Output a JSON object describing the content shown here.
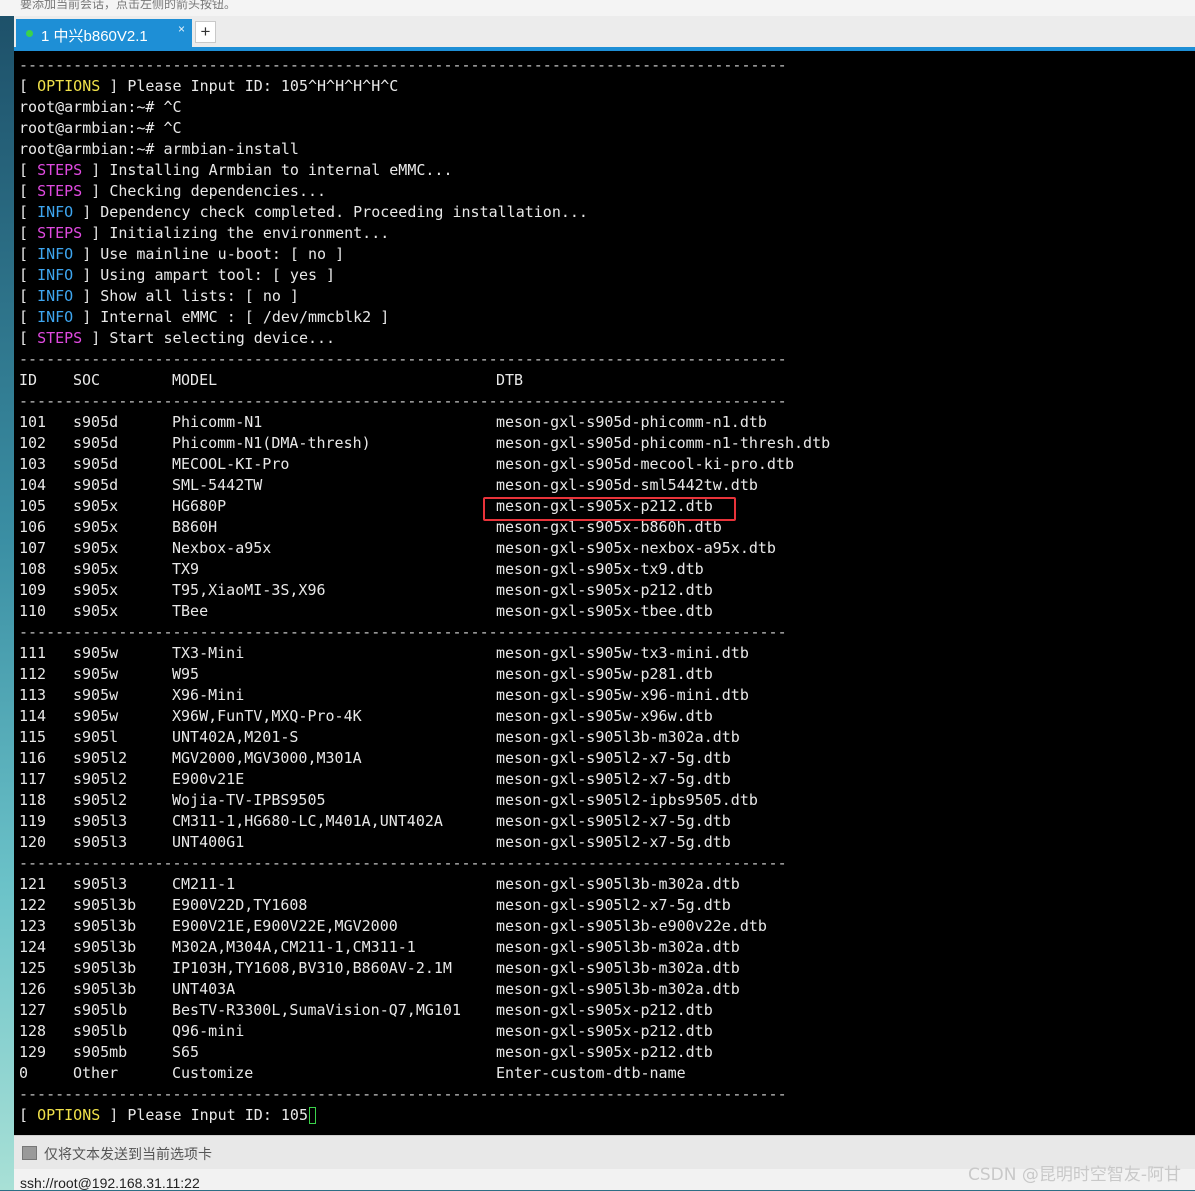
{
  "top_strip_text": "要添加当前会话，点击左侧的箭头按钮。",
  "tab": {
    "label": "1 中兴b860V2.1",
    "close": "×"
  },
  "new_tab_button": "+",
  "terminal": {
    "separator": "-------------------------------------------------------------------------------------",
    "pre_lines": [
      {
        "tag": "OPTIONS",
        "tag_color": "yellow",
        "text": "Please Input ID: 105^H^H^H^H^C"
      },
      {
        "plain": "root@armbian:~# ^C"
      },
      {
        "plain": "root@armbian:~# ^C"
      },
      {
        "plain": "root@armbian:~# armbian-install"
      },
      {
        "tag": "STEPS",
        "tag_color": "magenta",
        "text": "Installing Armbian to internal eMMC..."
      },
      {
        "tag": "STEPS",
        "tag_color": "magenta",
        "text": "Checking dependencies..."
      },
      {
        "tag": "INFO",
        "tag_color": "cyan",
        "text": "Dependency check completed. Proceeding installation..."
      },
      {
        "tag": "STEPS",
        "tag_color": "magenta",
        "text": "Initializing the environment..."
      },
      {
        "tag": "INFO",
        "tag_color": "cyan",
        "text": "Use mainline u-boot: [ no ]"
      },
      {
        "tag": "INFO",
        "tag_color": "cyan",
        "text": "Using ampart tool: [ yes ]"
      },
      {
        "tag": "INFO",
        "tag_color": "cyan",
        "text": "Show all lists: [ no ]"
      },
      {
        "tag": "INFO",
        "tag_color": "cyan",
        "text": "Internal eMMC : [ /dev/mmcblk2 ]"
      },
      {
        "tag": "STEPS",
        "tag_color": "magenta",
        "text": "Start selecting device..."
      }
    ],
    "table_headers": [
      "ID",
      "SOC",
      "MODEL",
      "DTB"
    ],
    "groups": [
      [
        [
          "101",
          "s905d",
          "Phicomm-N1",
          "meson-gxl-s905d-phicomm-n1.dtb"
        ],
        [
          "102",
          "s905d",
          "Phicomm-N1(DMA-thresh)",
          "meson-gxl-s905d-phicomm-n1-thresh.dtb"
        ],
        [
          "103",
          "s905d",
          "MECOOL-KI-Pro",
          "meson-gxl-s905d-mecool-ki-pro.dtb"
        ],
        [
          "104",
          "s905d",
          "SML-5442TW",
          "meson-gxl-s905d-sml5442tw.dtb"
        ],
        [
          "105",
          "s905x",
          "HG680P",
          "meson-gxl-s905x-p212.dtb"
        ],
        [
          "106",
          "s905x",
          "B860H",
          "meson-gxl-s905x-b860h.dtb"
        ],
        [
          "107",
          "s905x",
          "Nexbox-a95x",
          "meson-gxl-s905x-nexbox-a95x.dtb"
        ],
        [
          "108",
          "s905x",
          "TX9",
          "meson-gxl-s905x-tx9.dtb"
        ],
        [
          "109",
          "s905x",
          "T95,XiaoMI-3S,X96",
          "meson-gxl-s905x-p212.dtb"
        ],
        [
          "110",
          "s905x",
          "TBee",
          "meson-gxl-s905x-tbee.dtb"
        ]
      ],
      [
        [
          "111",
          "s905w",
          "TX3-Mini",
          "meson-gxl-s905w-tx3-mini.dtb"
        ],
        [
          "112",
          "s905w",
          "W95",
          "meson-gxl-s905w-p281.dtb"
        ],
        [
          "113",
          "s905w",
          "X96-Mini",
          "meson-gxl-s905w-x96-mini.dtb"
        ],
        [
          "114",
          "s905w",
          "X96W,FunTV,MXQ-Pro-4K",
          "meson-gxl-s905w-x96w.dtb"
        ],
        [
          "115",
          "s905l",
          "UNT402A,M201-S",
          "meson-gxl-s905l3b-m302a.dtb"
        ],
        [
          "116",
          "s905l2",
          "MGV2000,MGV3000,M301A",
          "meson-gxl-s905l2-x7-5g.dtb"
        ],
        [
          "117",
          "s905l2",
          "E900v21E",
          "meson-gxl-s905l2-x7-5g.dtb"
        ],
        [
          "118",
          "s905l2",
          "Wojia-TV-IPBS9505",
          "meson-gxl-s905l2-ipbs9505.dtb"
        ],
        [
          "119",
          "s905l3",
          "CM311-1,HG680-LC,M401A,UNT402A",
          "meson-gxl-s905l2-x7-5g.dtb"
        ],
        [
          "120",
          "s905l3",
          "UNT400G1",
          "meson-gxl-s905l2-x7-5g.dtb"
        ]
      ],
      [
        [
          "121",
          "s905l3",
          "CM211-1",
          "meson-gxl-s905l3b-m302a.dtb"
        ],
        [
          "122",
          "s905l3b",
          "E900V22D,TY1608",
          "meson-gxl-s905l2-x7-5g.dtb"
        ],
        [
          "123",
          "s905l3b",
          "E900V21E,E900V22E,MGV2000",
          "meson-gxl-s905l3b-e900v22e.dtb"
        ],
        [
          "124",
          "s905l3b",
          "M302A,M304A,CM211-1,CM311-1",
          "meson-gxl-s905l3b-m302a.dtb"
        ],
        [
          "125",
          "s905l3b",
          "IP103H,TY1608,BV310,B860AV-2.1M",
          "meson-gxl-s905l3b-m302a.dtb"
        ],
        [
          "126",
          "s905l3b",
          "UNT403A",
          "meson-gxl-s905l3b-m302a.dtb"
        ],
        [
          "127",
          "s905lb",
          "BesTV-R3300L,SumaVision-Q7,MG101",
          "meson-gxl-s905x-p212.dtb"
        ],
        [
          "128",
          "s905lb",
          "Q96-mini",
          "meson-gxl-s905x-p212.dtb"
        ],
        [
          "129",
          "s905mb",
          "S65",
          "meson-gxl-s905x-p212.dtb"
        ],
        [
          "0",
          "Other",
          "Customize",
          "Enter-custom-dtb-name"
        ]
      ]
    ],
    "highlighted_id": "105",
    "prompt": {
      "tag": "OPTIONS",
      "text": "Please Input ID: 105"
    }
  },
  "send_bar_text": "仅将文本发送到当前选项卡",
  "status_bar_text": "ssh://root@192.168.31.11:22",
  "watermark": "CSDN @昆明时空智友-阿甘",
  "colors": {
    "tab": "#1e8fd6",
    "yellow": "#f0e14a",
    "magenta": "#e04ae0",
    "cyan": "#3ea6f0",
    "highlight": "#e8333a",
    "cursor": "#3bd24b"
  }
}
